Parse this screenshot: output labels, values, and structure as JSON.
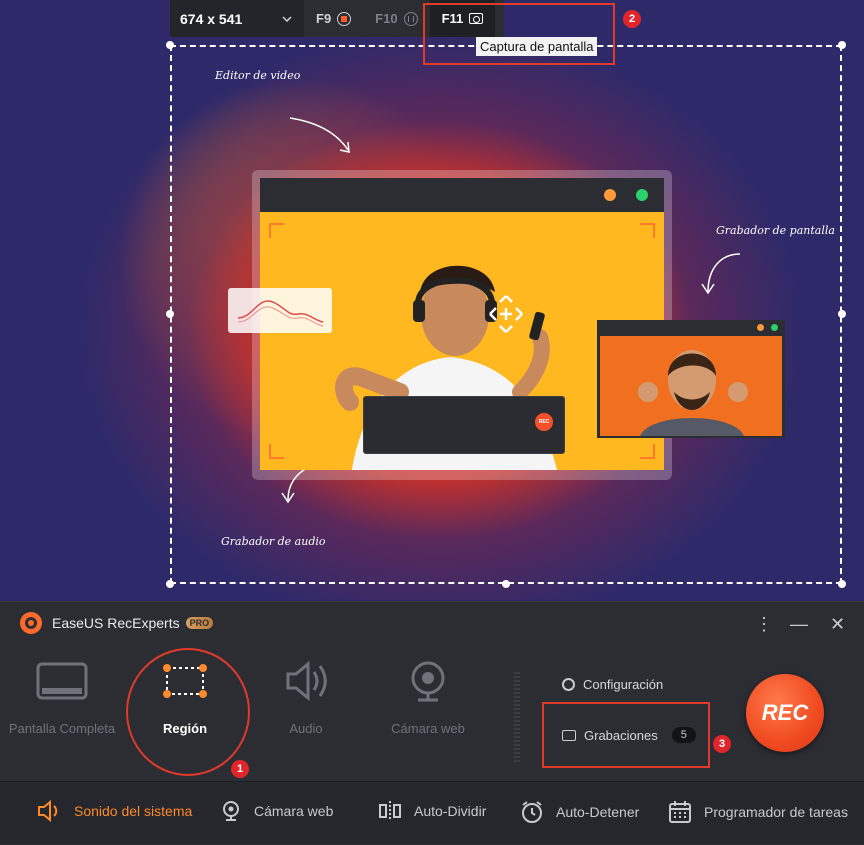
{
  "toolbar": {
    "size_label": "674 x 541",
    "f9_label": "F9",
    "f10_label": "F10",
    "f11_label": "F11",
    "tooltip": "Captura de pantalla"
  },
  "annotations": {
    "badge1": "1",
    "badge2": "2",
    "badge3": "3"
  },
  "preview": {
    "label_editor": "Editor de video",
    "label_screen": "Grabador de pantalla",
    "label_audio": "Grabador de audio",
    "mini_rec": "REC"
  },
  "app": {
    "title": "EaseUS RecExperts",
    "pro_badge": "PRO",
    "modes": [
      {
        "label": "Pantalla Completa",
        "icon": "monitor-icon"
      },
      {
        "label": "Región",
        "icon": "region-icon"
      },
      {
        "label": "Audio",
        "icon": "speaker-icon"
      },
      {
        "label": "Cámara web",
        "icon": "webcam-icon"
      }
    ],
    "settings_label": "Configuración",
    "recordings_label": "Grabaciones",
    "recordings_count": "5",
    "rec_label": "REC",
    "bottom": [
      {
        "label": "Sonido del sistema",
        "icon": "speaker-icon"
      },
      {
        "label": "Cámara web",
        "icon": "webcam-icon"
      },
      {
        "label": "Auto-Dividir",
        "icon": "split-icon"
      },
      {
        "label": "Auto-Detener",
        "icon": "alarm-clock-icon"
      },
      {
        "label": "Programador de tareas",
        "icon": "calendar-icon"
      }
    ]
  },
  "colors": {
    "accent": "#ff6a2a",
    "annotation_red": "#e23a2a"
  }
}
